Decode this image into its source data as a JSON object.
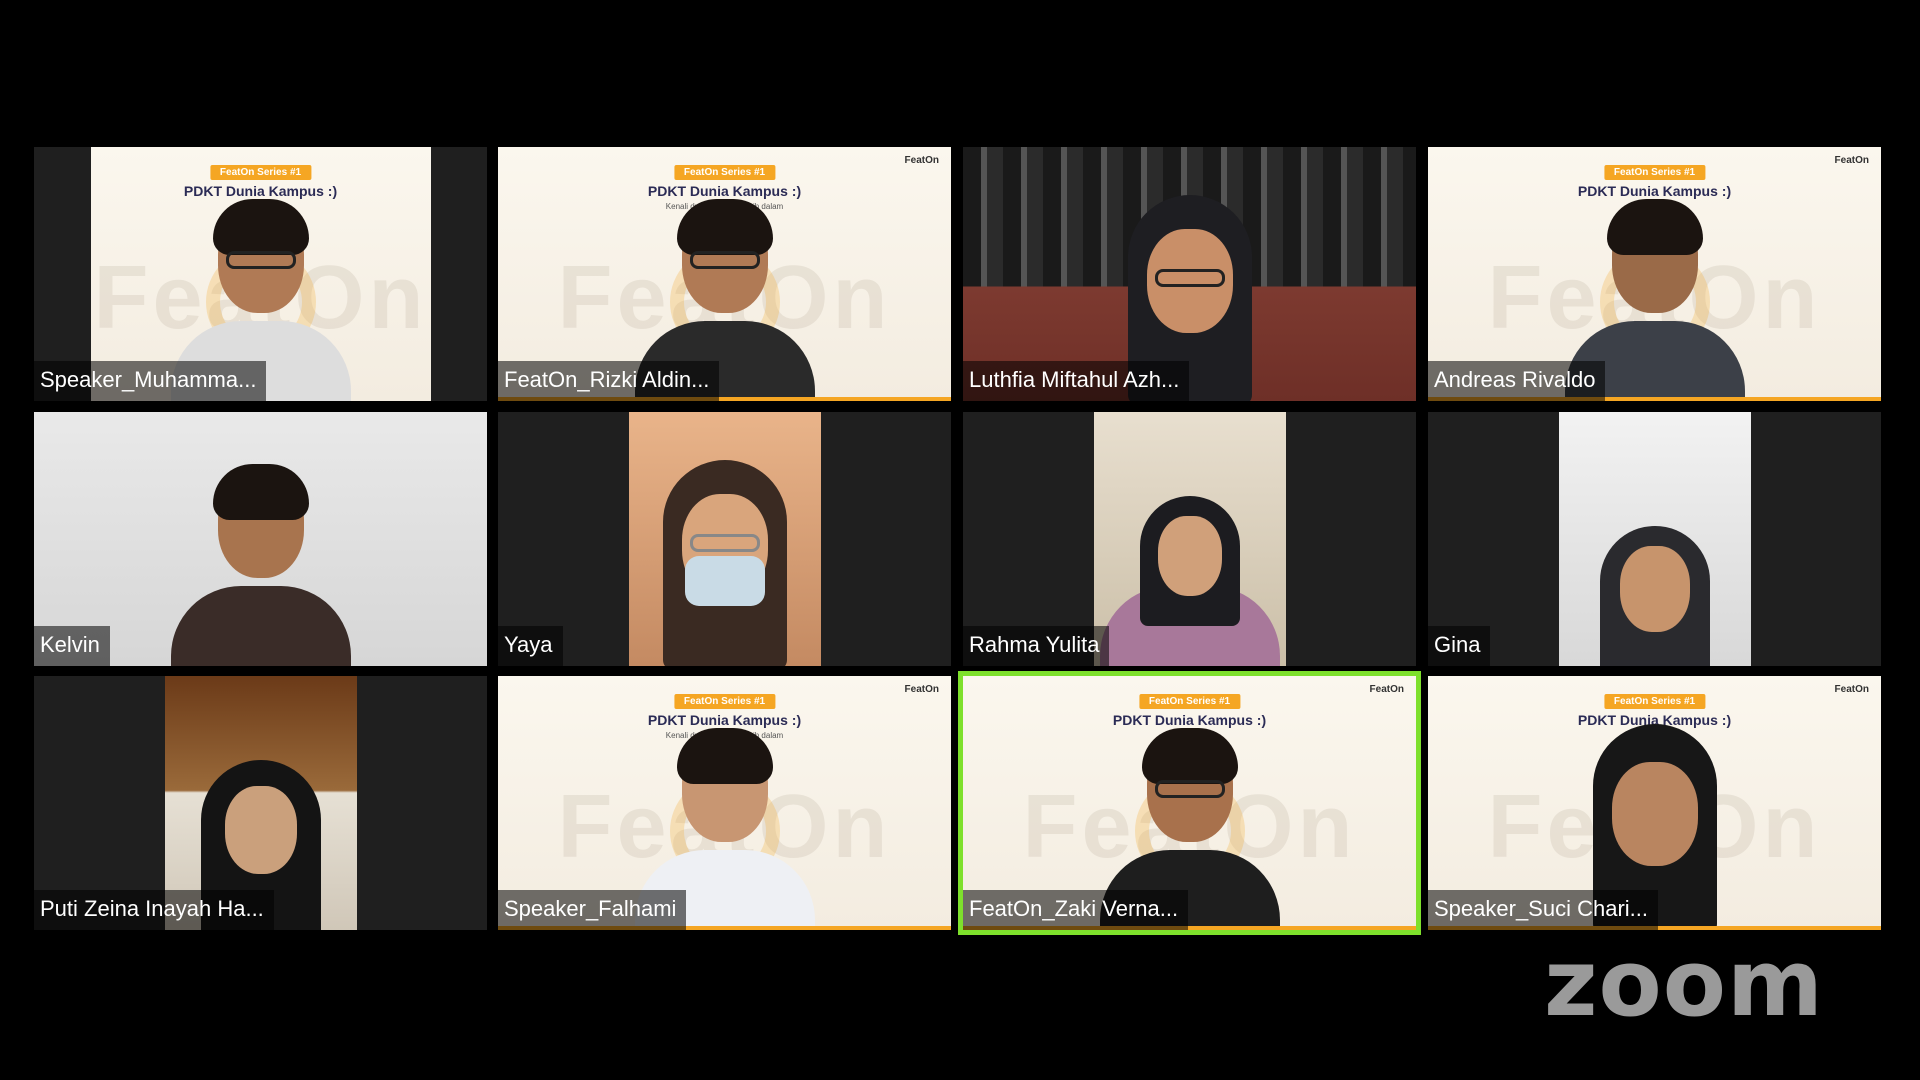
{
  "app": {
    "logo_text": "zoom"
  },
  "banner": {
    "badge": "FeatOn Series #1",
    "title": "PDKT Dunia Kampus :)",
    "subtitle": "Kenali dunia kampus lebih dalam",
    "logo": "FeatOn",
    "watermark": "FeatOn"
  },
  "participants": [
    {
      "name": "Speaker_Muhamma...",
      "active": false
    },
    {
      "name": "FeatOn_Rizki Aldin...",
      "active": false
    },
    {
      "name": "Luthfia Miftahul Azh...",
      "active": false
    },
    {
      "name": "Andreas Rivaldo",
      "active": false
    },
    {
      "name": "Kelvin",
      "active": false
    },
    {
      "name": "Yaya",
      "active": false
    },
    {
      "name": "Rahma Yulita",
      "active": false
    },
    {
      "name": "Gina",
      "active": false
    },
    {
      "name": "Puti Zeina Inayah Ha...",
      "active": false
    },
    {
      "name": "Speaker_Falhami",
      "active": false
    },
    {
      "name": "FeatOn_Zaki Verna...",
      "active": true
    },
    {
      "name": "Speaker_Suci Chari...",
      "active": false
    }
  ],
  "colors": {
    "active_speaker_border": "#7ee02c",
    "featon_accent": "#f5a623",
    "background": "#000000"
  }
}
